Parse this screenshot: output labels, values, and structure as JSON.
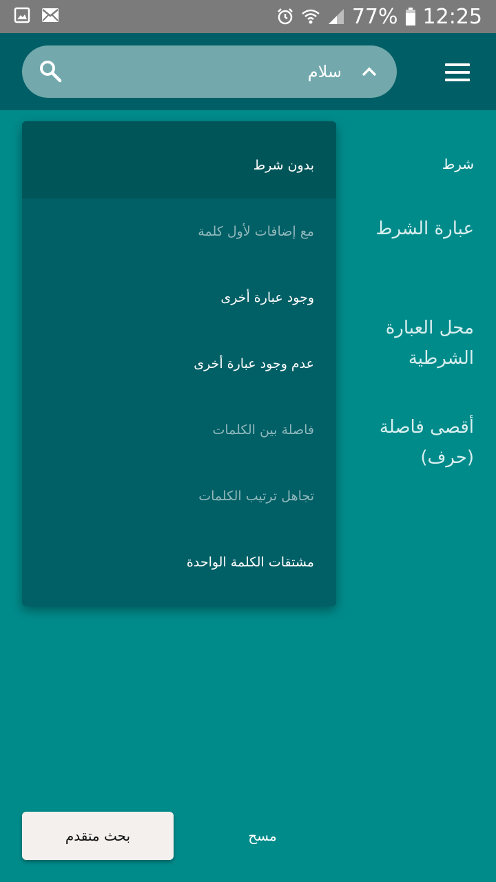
{
  "status_bar": {
    "battery": "77%",
    "time": "12:25",
    "icons": [
      "image-icon",
      "mail-icon",
      "alarm-icon",
      "wifi-icon",
      "signal-icon",
      "battery-icon"
    ]
  },
  "search": {
    "value": "سلام"
  },
  "form": {
    "labels": {
      "condition": "شرط",
      "condition_phrase": "عبارة الشرط",
      "condition_location_line1": "محل العبارة",
      "condition_location_line2": "الشرطية",
      "max_distance_line1": "أقصى فاصلة",
      "max_distance_line2": "(حرف)"
    }
  },
  "dropdown": {
    "items": [
      {
        "label": "بدون شرط",
        "state": "selected"
      },
      {
        "label": "مع إضافات لأول كلمة",
        "state": "disabled"
      },
      {
        "label": "وجود عبارة أخرى",
        "state": "enabled"
      },
      {
        "label": "عدم وجود عبارة أخرى",
        "state": "enabled"
      },
      {
        "label": "فاصلة بين الكلمات",
        "state": "disabled"
      },
      {
        "label": "تجاهل ترتيب الكلمات",
        "state": "disabled"
      },
      {
        "label": "مشتقات الكلمة الواحدة",
        "state": "enabled"
      }
    ]
  },
  "buttons": {
    "advanced_search": "بحث متقدم",
    "clear": "مسح"
  },
  "colors": {
    "background": "#008b8b",
    "app_bar": "#005f66",
    "search_box": "#73a9ad",
    "dropdown": "#015f66",
    "status_bar": "#7b7b7b"
  }
}
